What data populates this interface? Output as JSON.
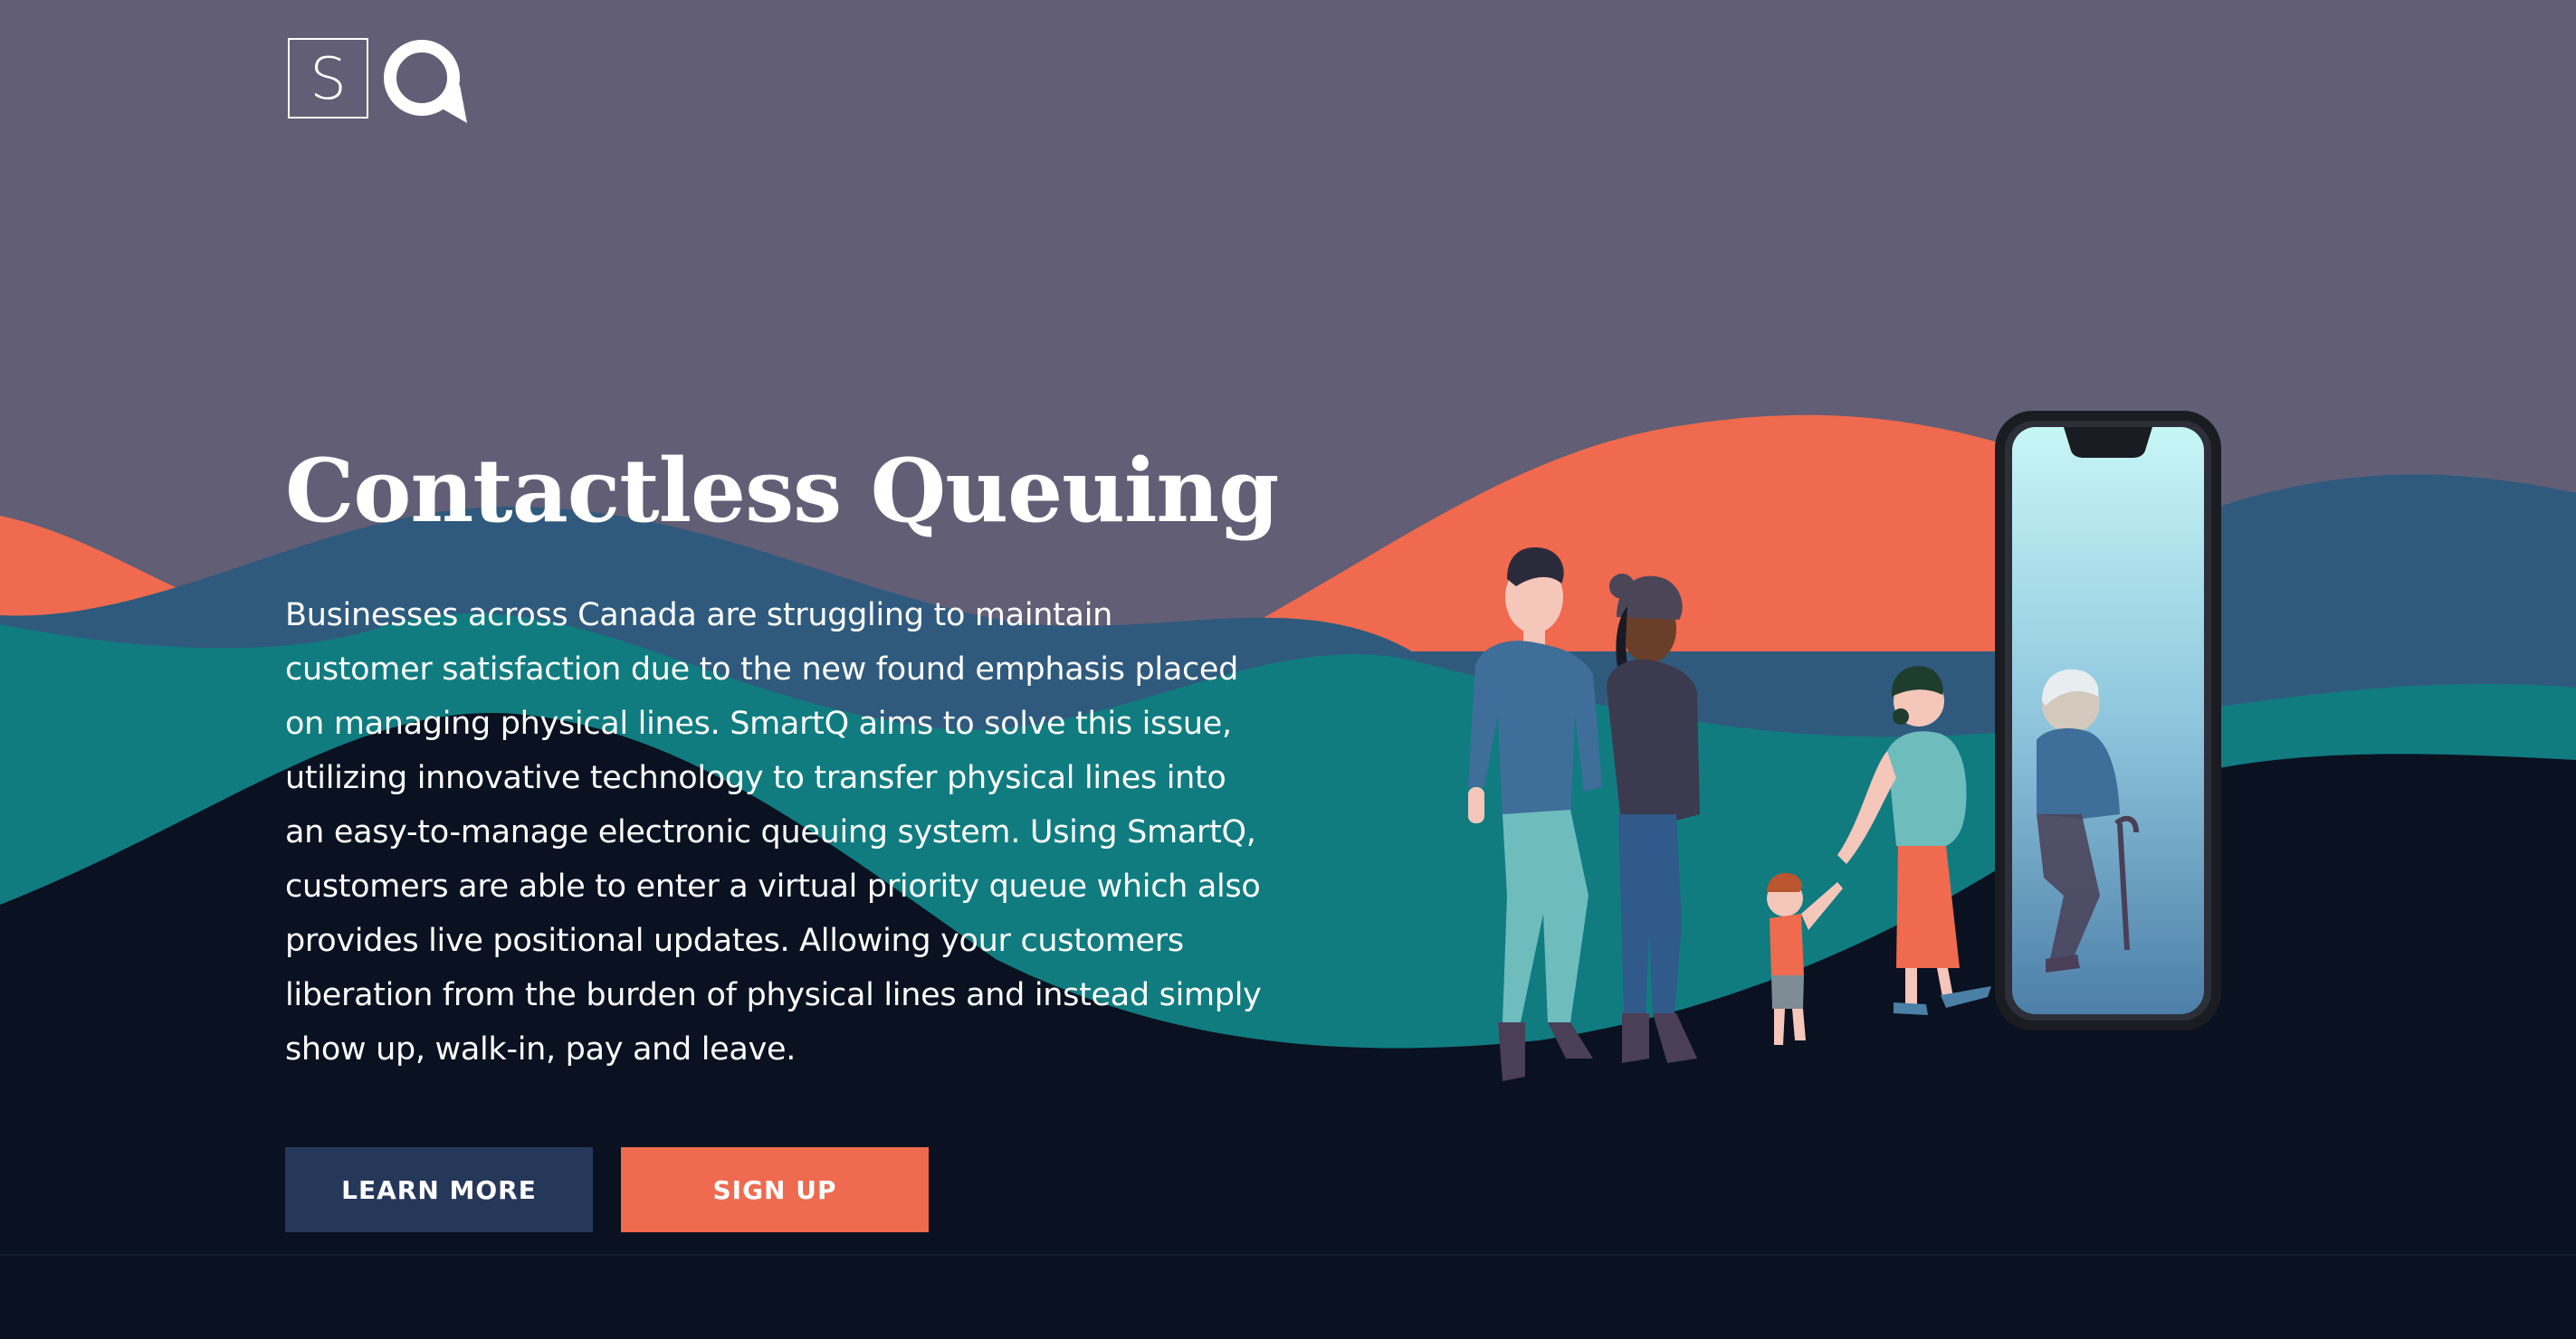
{
  "brand": {
    "logo_letter": "S",
    "logo_icon": "q-speech-bubble-icon"
  },
  "hero": {
    "title": "Contactless Queuing",
    "description": "Businesses across Canada are struggling to maintain customer satisfaction due to the new found emphasis placed on managing physical lines. SmartQ aims to solve this issue, utilizing innovative technology to transfer physical lines into an easy-to-manage electronic queuing system. Using SmartQ, customers are able to enter a virtual priority queue which also provides live positional updates. Allowing your customers liberation from the burden of physical lines and instead simply show up, walk-in, pay and leave."
  },
  "buttons": {
    "learn_more": "LEARN MORE",
    "sign_up": "SIGN UP"
  },
  "colors": {
    "sky": "#615e75",
    "orange_hill": "#ef6a4e",
    "blue_hill": "#2f5a7d",
    "teal_hill": "#107c80",
    "dark_ground": "#0a1120",
    "learn_more_button": "#26385a",
    "sign_up_button": "#ef6a4e"
  },
  "illustration": {
    "people": [
      "man",
      "woman-with-beanie",
      "child",
      "pregnant-woman",
      "elderly-man-with-cane"
    ],
    "device": "smartphone"
  }
}
